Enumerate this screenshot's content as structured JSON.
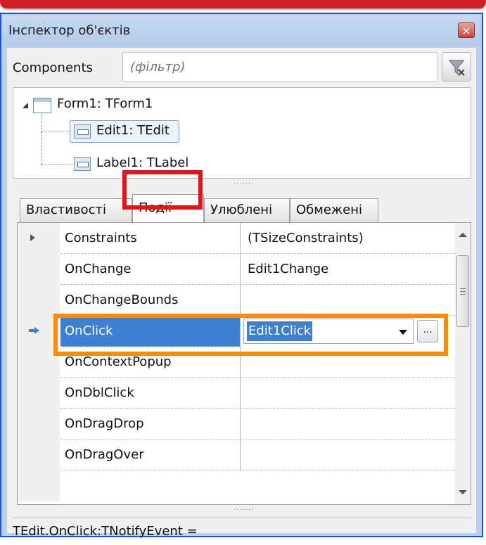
{
  "window": {
    "title": "Інспектор об'єктів",
    "close_symbol": "×"
  },
  "components": {
    "label": "Components",
    "filter_placeholder": "(фільтр)"
  },
  "tree": {
    "nodes": [
      {
        "label": "Form1: TForm1"
      },
      {
        "label": "Edit1: TEdit"
      },
      {
        "label": "Label1: TLabel"
      }
    ]
  },
  "tabs": [
    {
      "label": "Властивості"
    },
    {
      "label": "Події"
    },
    {
      "label": "Улюблені"
    },
    {
      "label": "Обмежені"
    }
  ],
  "active_tab": "Події",
  "grid": {
    "rows": [
      {
        "name": "Constraints",
        "value": "(TSizeConstraints)"
      },
      {
        "name": "OnChange",
        "value": "Edit1Change"
      },
      {
        "name": "OnChangeBounds",
        "value": ""
      },
      {
        "name": "OnClick",
        "value": "Edit1Click"
      },
      {
        "name": "OnContextPopup",
        "value": ""
      },
      {
        "name": "OnDblClick",
        "value": ""
      },
      {
        "name": "OnDragDrop",
        "value": ""
      },
      {
        "name": "OnDragOver",
        "value": ""
      }
    ],
    "ellipsis": "..."
  },
  "status": {
    "text": "TEdit.OnClick:TNotifyEvent ="
  },
  "colors": {
    "selection": "#3d7fd0",
    "tab_highlight": "#e3131b",
    "row_highlight": "#ff8c00",
    "frame_border": "#1e4fd6"
  }
}
